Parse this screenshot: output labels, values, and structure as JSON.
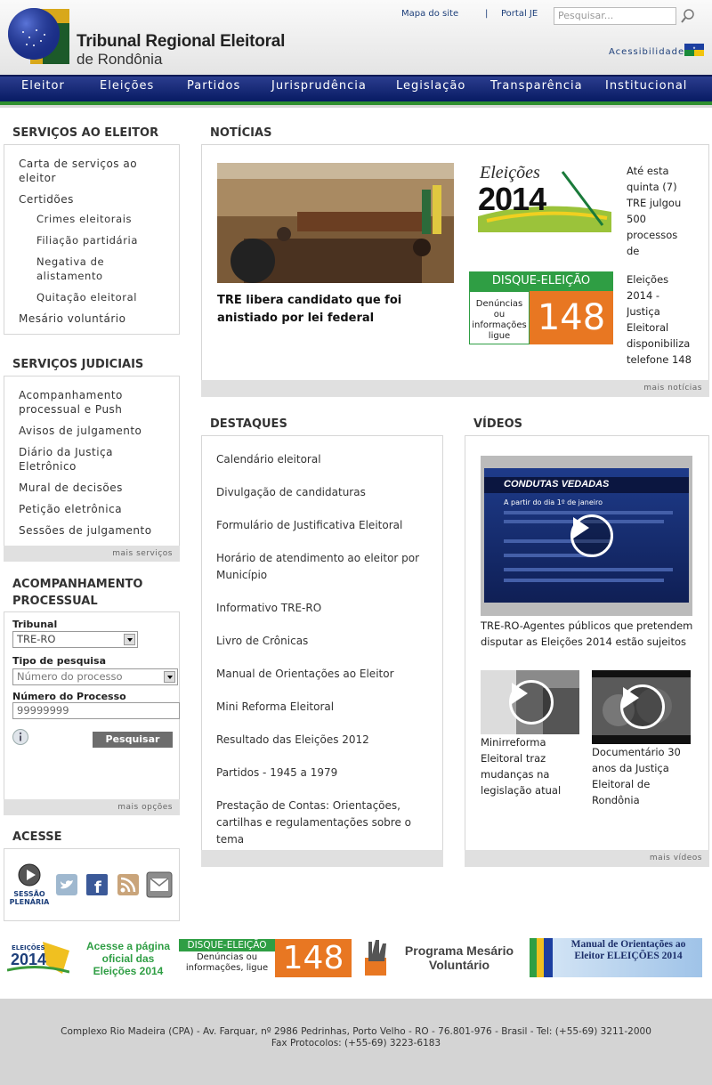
{
  "header": {
    "title_line1": "Tribunal Regional Eleitoral",
    "title_line2": "de Rondônia",
    "sitemap_link": "Mapa do site",
    "separator": "|",
    "portal_link": "Portal JE",
    "search_placeholder": "Pesquisar...",
    "accessibility_link": "Acessibilidade"
  },
  "nav": [
    "Eleitor",
    "Eleições",
    "Partidos",
    "Jurisprudência",
    "Legislação",
    "Transparência",
    "Institucional"
  ],
  "servicos_eleitor": {
    "title": "SERVIÇOS AO ELEITOR",
    "items": [
      "Carta de serviços ao eleitor",
      "Certidões",
      "Crimes eleitorais",
      "Filiação partidária",
      "Negativa de alistamento",
      "Quitação eleitoral",
      "Mesário voluntário"
    ]
  },
  "servicos_judiciais": {
    "title": "SERVIÇOS JUDICIAIS",
    "items": [
      "Acompanhamento processual e Push",
      "Avisos de julgamento",
      "Diário da Justiça Eletrônico",
      "Mural de decisões",
      "Petição eletrônica",
      "Sessões de julgamento"
    ],
    "more": "mais serviços"
  },
  "acompanhamento": {
    "title": "ACOMPANHAMENTO PROCESSUAL",
    "tribunal_label": "Tribunal",
    "tribunal_value": "TRE-RO",
    "tipo_label": "Tipo de pesquisa",
    "tipo_value": "Número do processo",
    "numero_label": "Número do Processo",
    "numero_value": "99999999",
    "button": "Pesquisar",
    "more": "mais opções"
  },
  "acesse": {
    "title": "ACESSE",
    "sessao_line1": "SESSÃO",
    "sessao_line2": "PLENÁRIA",
    "icons": [
      "twitter-icon",
      "facebook-icon",
      "rss-icon",
      "email-icon"
    ]
  },
  "noticias": {
    "title": "NOTÍCIAS",
    "headline": "TRE libera candidato que foi anistiado por lei federal",
    "item1": "Até esta quinta (7) TRE julgou 500 processos de",
    "item1_thumb_top": "Eleições",
    "item1_thumb_year": "2014",
    "item2": "Eleições 2014 - Justiça Eleitoral disponibiliza telefone 148",
    "item2_thumb_top": "DISQUE-ELEIÇÃO",
    "item2_thumb_text": "Denúncias ou informações ligue",
    "item2_thumb_num": "148",
    "more": "mais notícias"
  },
  "destaques": {
    "title": "DESTAQUES",
    "items": [
      "Calendário eleitoral",
      "Divulgação de candidaturas",
      "Formulário de Justificativa Eleitoral",
      "Horário de atendimento ao eleitor por Município",
      "Informativo TRE-RO",
      "Livro de Crônicas",
      "Manual de Orientações ao Eleitor",
      "Mini Reforma Eleitoral",
      "Resultado das Eleições 2012",
      "Partidos - 1945 a 1979",
      "Prestação de Contas: Orientações, cartilhas e regulamentações sobre o tema"
    ]
  },
  "videos": {
    "title": "VÍDEOS",
    "main_slide_title": "CONDUTAS VEDADAS",
    "main_slide_sub": "A partir do dia 1º de janeiro",
    "main_caption": "TRE-RO-Agentes públicos que pretendem disputar as Eleições 2014 estão sujeitos a",
    "video2": "Minirreforma Eleitoral traz mudanças na legislação atual",
    "video3": "Documentário 30 anos da Justiça Eleitoral de Rondônia",
    "more": "mais vídeos"
  },
  "banners": {
    "b1_year": "2014",
    "b1_top": "ELEIÇÕES",
    "b1_text": "Acesse a página oficial das Eleições 2014",
    "b2_top": "DISQUE-ELEIÇÃO",
    "b2_text": "Denúncias ou informações, ligue",
    "b2_num": "148",
    "b3_text": "Programa Mesário Voluntário",
    "b4_text": "Manual de Orientações ao Eleitor ELEIÇÕES 2014"
  },
  "footer": {
    "address": "Complexo Rio Madeira (CPA) - Av. Farquar, nº 2986 Pedrinhas, Porto Velho - RO - 76.801-976 - Brasil - Tel: (+55-69) 3211-2000",
    "fax": "Fax Protocolos: (+55-69) 3223-6183"
  },
  "colors": {
    "nav": "#0a1d66",
    "green": "#2f8f2f",
    "accent": "#e87722"
  }
}
